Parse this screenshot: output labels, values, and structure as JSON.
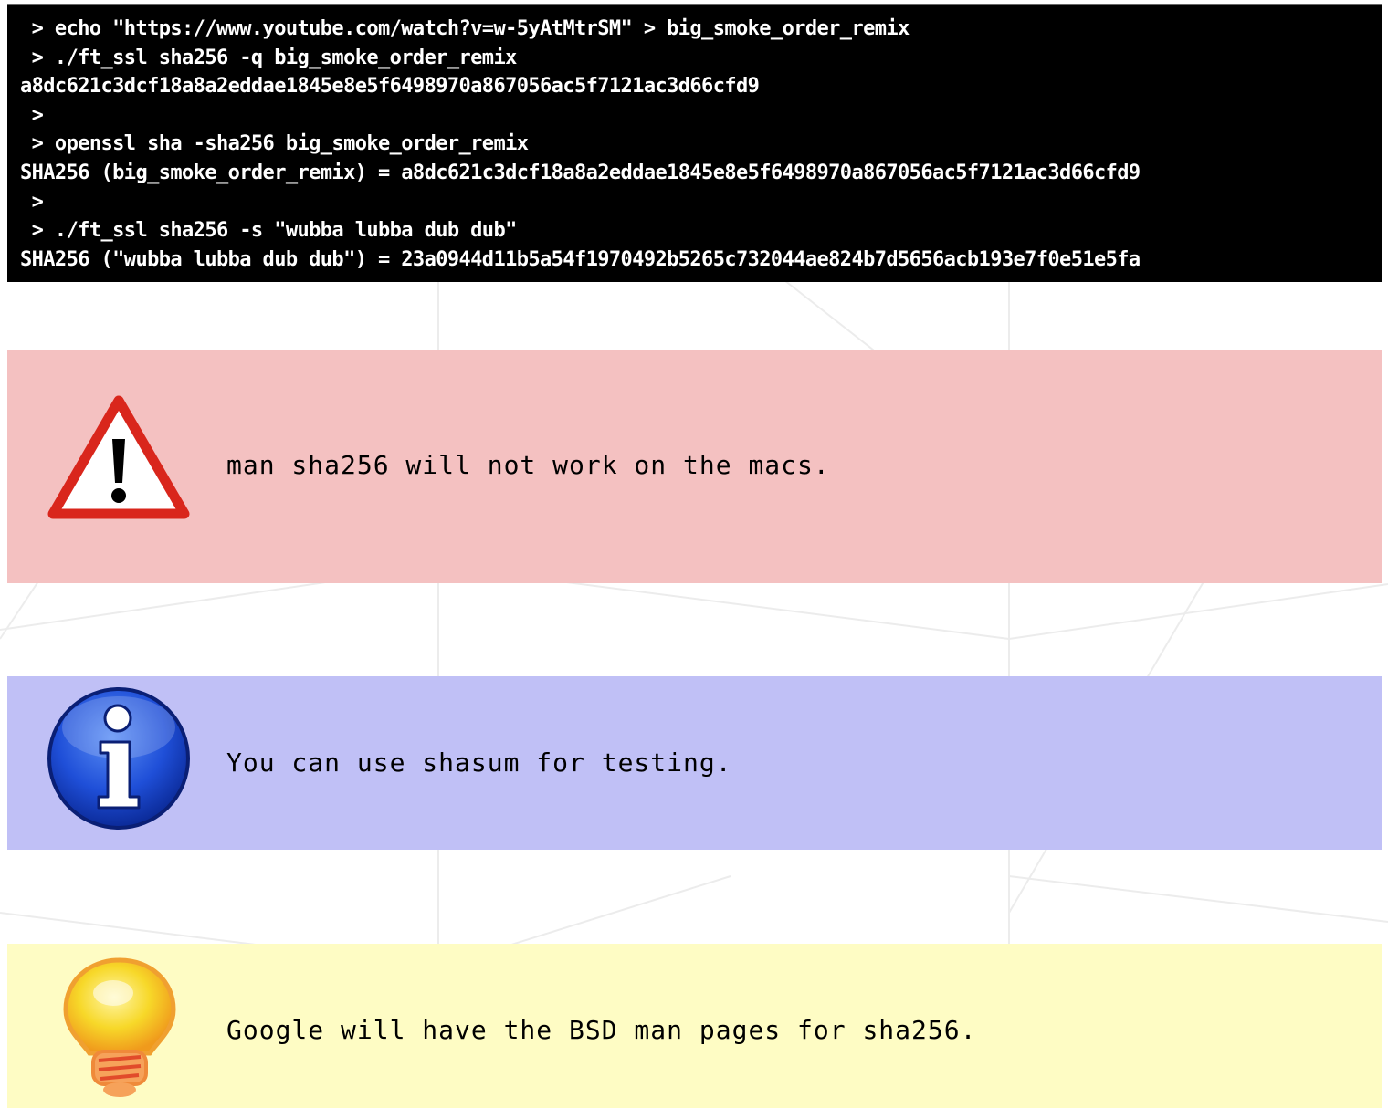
{
  "terminal": {
    "lines": [
      " > echo \"https://www.youtube.com/watch?v=w-5yAtMtrSM\" > big_smoke_order_remix",
      " > ./ft_ssl sha256 -q big_smoke_order_remix",
      "a8dc621c3dcf18a8a2eddae1845e8e5f6498970a867056ac5f7121ac3d66cfd9",
      " >",
      " > openssl sha -sha256 big_smoke_order_remix",
      "SHA256 (big_smoke_order_remix) = a8dc621c3dcf18a8a2eddae1845e8e5f6498970a867056ac5f7121ac3d66cfd9",
      " >",
      " > ./ft_ssl sha256 -s \"wubba lubba dub dub\"",
      "SHA256 (\"wubba lubba dub dub\") = 23a0944d11b5a54f1970492b5265c732044ae824b7d5656acb193e7f0e51e5fa"
    ]
  },
  "notes": {
    "warning": {
      "text": "man sha256 will not work on the macs.",
      "icon": "warning-triangle-icon"
    },
    "info": {
      "text": "You can use shasum for testing.",
      "icon": "info-icon"
    },
    "tip": {
      "text": "Google will have the BSD man pages for sha256.",
      "icon": "lightbulb-icon"
    }
  },
  "colors": {
    "terminal_bg": "#000000",
    "warning_bg": "#f4c1c1",
    "info_bg": "#c0c0f6",
    "tip_bg": "#fefcc4"
  }
}
